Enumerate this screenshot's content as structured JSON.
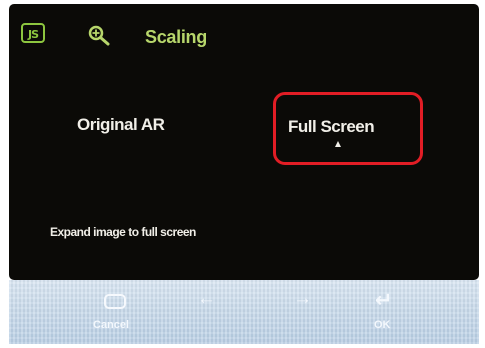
{
  "osd": {
    "brand_icon_text": "JS",
    "brand_icon": "brand-icon",
    "zoom_icon": "magnify-icon",
    "title": "Scaling",
    "options": [
      {
        "label": "Original AR",
        "selected": false
      },
      {
        "label": "Full Screen",
        "selected": true
      }
    ],
    "description": "Expand image to full screen"
  },
  "controls": {
    "cancel_icon": "cancel-icon",
    "cancel_label": "Cancel",
    "left_icon": "←",
    "right_icon": "→",
    "enter_icon": "↵",
    "ok_label": "OK"
  },
  "colors": {
    "screen_background": "#0b0a07",
    "accent_green": "#8dc63f",
    "title_green": "#b7d66b",
    "selection_red": "#e21d25",
    "control_bar": "#c7d9ea"
  }
}
